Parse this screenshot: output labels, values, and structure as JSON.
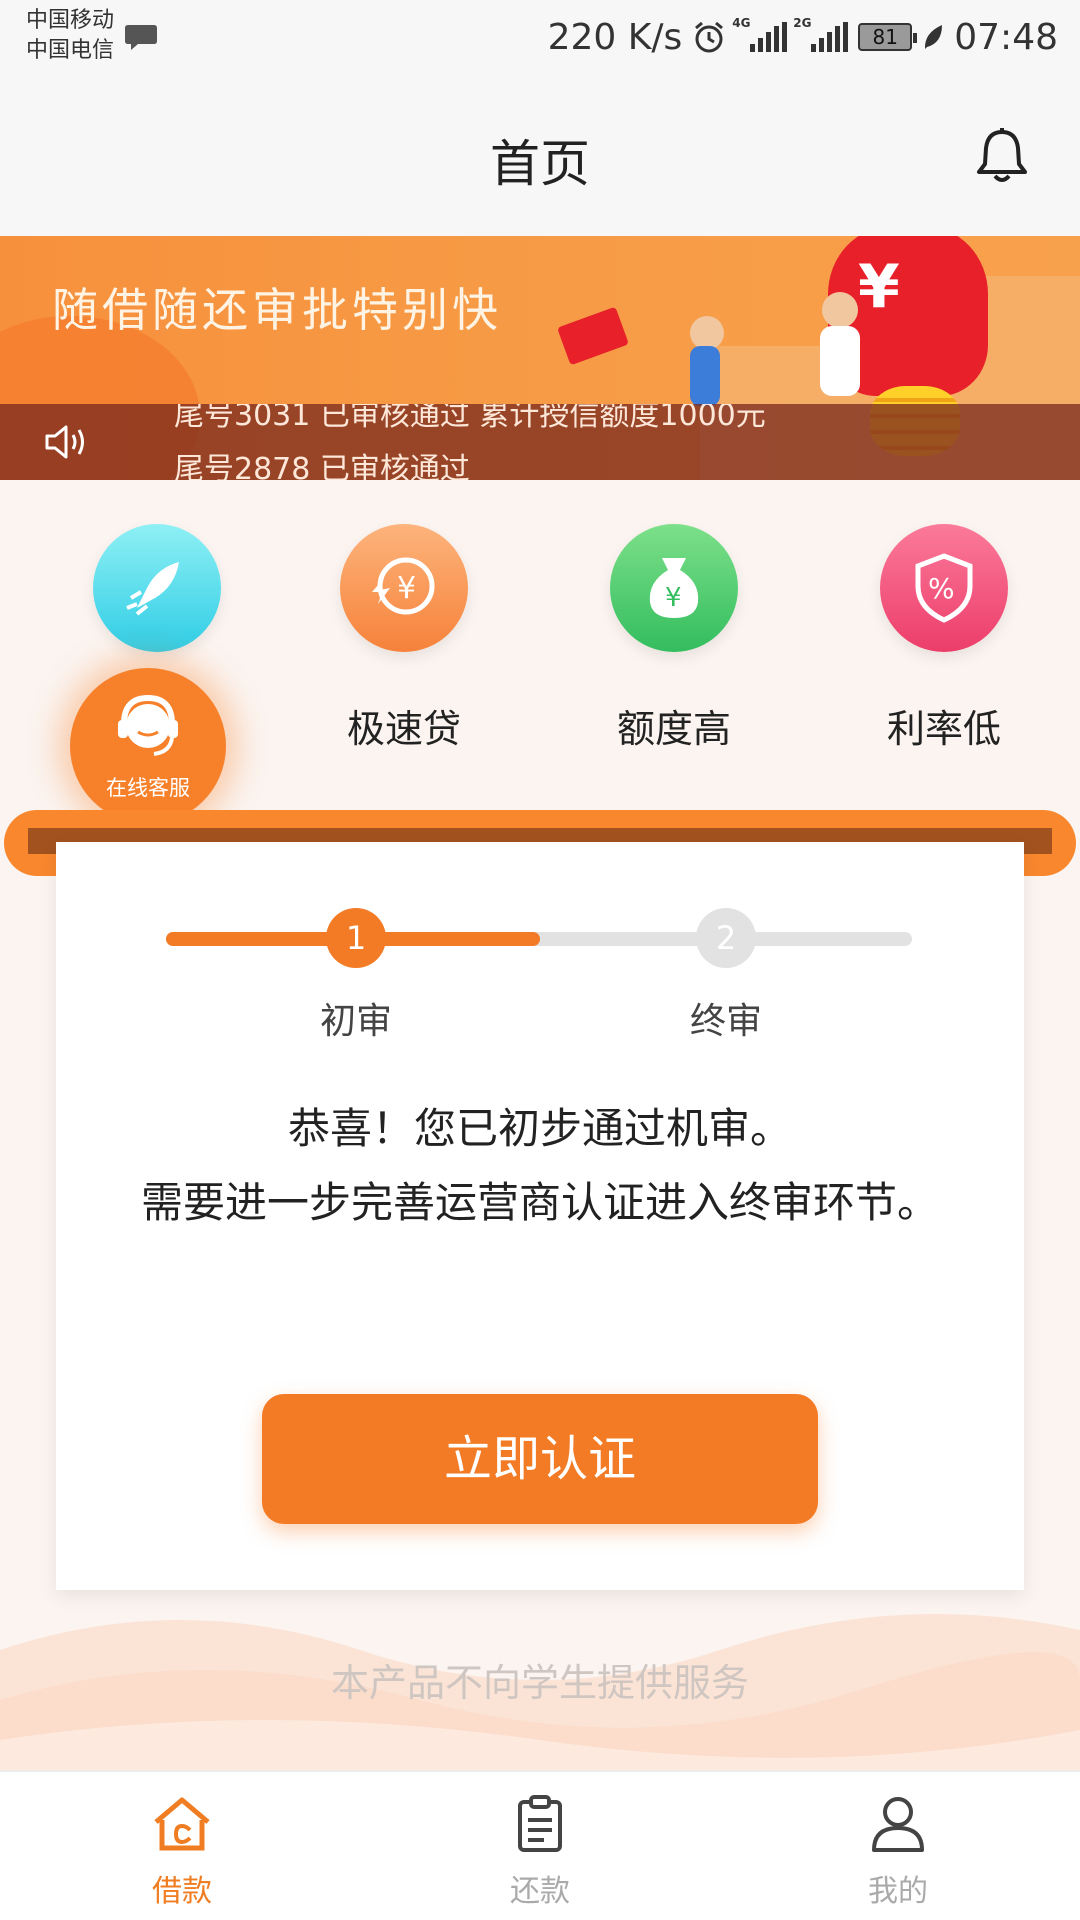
{
  "status_bar": {
    "carrier_1": "中国移动",
    "carrier_2": "中国电信",
    "net_speed": "220 K/s",
    "signal_1_tag": "4G",
    "signal_2_tag": "2G",
    "battery": "81",
    "time": "07:48"
  },
  "header": {
    "title": "首页",
    "bell_icon": "bell-icon"
  },
  "banner": {
    "slogan": "随借随还审批特别快",
    "ticker": [
      "尾号3031 已审核通过 累计授信额度1000元",
      "尾号2878 已审核通过"
    ],
    "speaker_icon": "speaker-icon"
  },
  "features": [
    {
      "icon": "rocket-icon",
      "label": ""
    },
    {
      "icon": "fast-loan-icon",
      "label": "极速贷"
    },
    {
      "icon": "money-bag-icon",
      "label": "额度高"
    },
    {
      "icon": "percent-shield-icon",
      "label": "利率低"
    }
  ],
  "customer_service": {
    "label": "在线客服"
  },
  "review": {
    "current_step": 1,
    "steps": [
      {
        "number": "1",
        "label": "初审"
      },
      {
        "number": "2",
        "label": "终审"
      }
    ],
    "message_line_1": "恭喜！您已初步通过机审。",
    "message_line_2": "需要进一步完善运营商认证进入终审环节。",
    "cta_label": "立即认证"
  },
  "disclaimer": "本产品不向学生提供服务",
  "bottom_nav": [
    {
      "label": "借款",
      "icon": "home-icon",
      "active": true
    },
    {
      "label": "还款",
      "icon": "clipboard-icon",
      "active": false
    },
    {
      "label": "我的",
      "icon": "person-icon",
      "active": false
    }
  ],
  "colors": {
    "accent": "#f37b26",
    "nav_active": "#f07d21",
    "nav_inactive": "#aaaaaa",
    "feature_cyan": "#3fd6e6",
    "feature_orange": "#f8914a",
    "feature_green": "#49c86b",
    "feature_pink": "#f04f7a"
  }
}
